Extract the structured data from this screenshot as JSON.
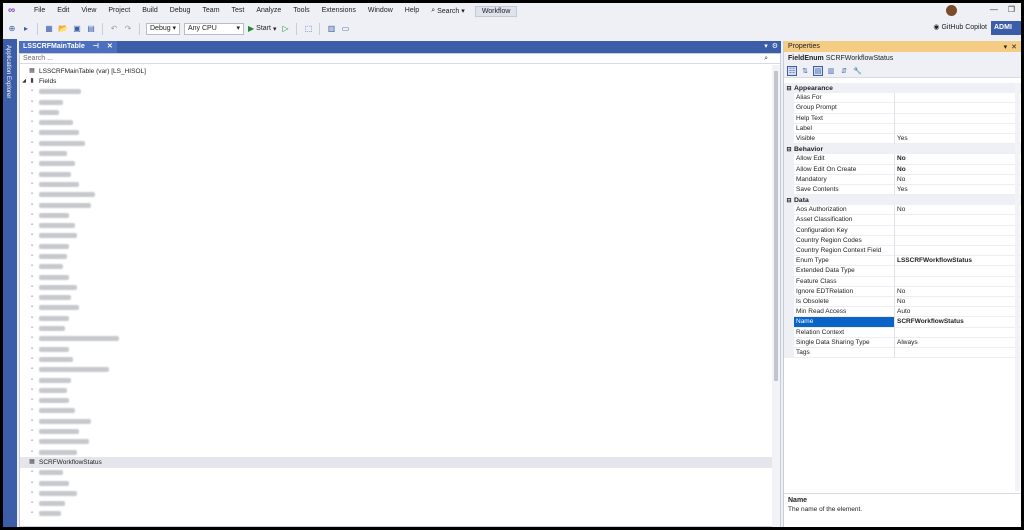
{
  "menubar": {
    "items": [
      "File",
      "Edit",
      "View",
      "Project",
      "Build",
      "Debug",
      "Team",
      "Test",
      "Analyze",
      "Tools",
      "Extensions",
      "Window",
      "Help"
    ],
    "search_label": "Search",
    "workflow_label": "Workflow"
  },
  "toolbar": {
    "config": "Debug",
    "platform": "Any CPU",
    "start_label": "Start",
    "copilot_label": "GitHub Copilot",
    "admin_label": "ADMI"
  },
  "side_strip": {
    "label": "Application Explorer"
  },
  "document": {
    "tab_title": "LSSCRFMainTable",
    "search_placeholder": "Search ...",
    "root_label": "LSSCRFMainTable (var) [LS_HISOL]",
    "fields_label": "Fields",
    "selected_field": "SCRFWorkflowStatus"
  },
  "properties": {
    "title": "Properties",
    "object_type": "FieldEnum",
    "object_name": "SCRFWorkflowStatus",
    "categories": [
      {
        "name": "Appearance",
        "rows": [
          {
            "name": "Alias For",
            "value": ""
          },
          {
            "name": "Group Prompt",
            "value": ""
          },
          {
            "name": "Help Text",
            "value": ""
          },
          {
            "name": "Label",
            "value": ""
          },
          {
            "name": "Visible",
            "value": "Yes"
          }
        ]
      },
      {
        "name": "Behavior",
        "rows": [
          {
            "name": "Allow Edit",
            "value": "No",
            "bold": true
          },
          {
            "name": "Allow Edit On Create",
            "value": "No",
            "bold": true
          },
          {
            "name": "Mandatory",
            "value": "No"
          },
          {
            "name": "Save Contents",
            "value": "Yes"
          }
        ]
      },
      {
        "name": "Data",
        "rows": [
          {
            "name": "Aos Authorization",
            "value": "No"
          },
          {
            "name": "Asset Classification",
            "value": ""
          },
          {
            "name": "Configuration Key",
            "value": ""
          },
          {
            "name": "Country Region Codes",
            "value": ""
          },
          {
            "name": "Country Region Context Field",
            "value": ""
          },
          {
            "name": "Enum Type",
            "value": "LSSCRFWorkflowStatus",
            "bold": true
          },
          {
            "name": "Extended Data Type",
            "value": ""
          },
          {
            "name": "Feature Class",
            "value": ""
          },
          {
            "name": "Ignore EDTRelation",
            "value": "No"
          },
          {
            "name": "Is Obsolete",
            "value": "No"
          },
          {
            "name": "Min Read Access",
            "value": "Auto"
          },
          {
            "name": "Name",
            "value": "SCRFWorkflowStatus",
            "bold": true,
            "selected": true
          },
          {
            "name": "Relation Context",
            "value": ""
          },
          {
            "name": "Single Data Sharing Type",
            "value": "Always"
          },
          {
            "name": "Tags",
            "value": ""
          }
        ]
      }
    ],
    "description": {
      "title": "Name",
      "text": "The name of the element."
    }
  }
}
